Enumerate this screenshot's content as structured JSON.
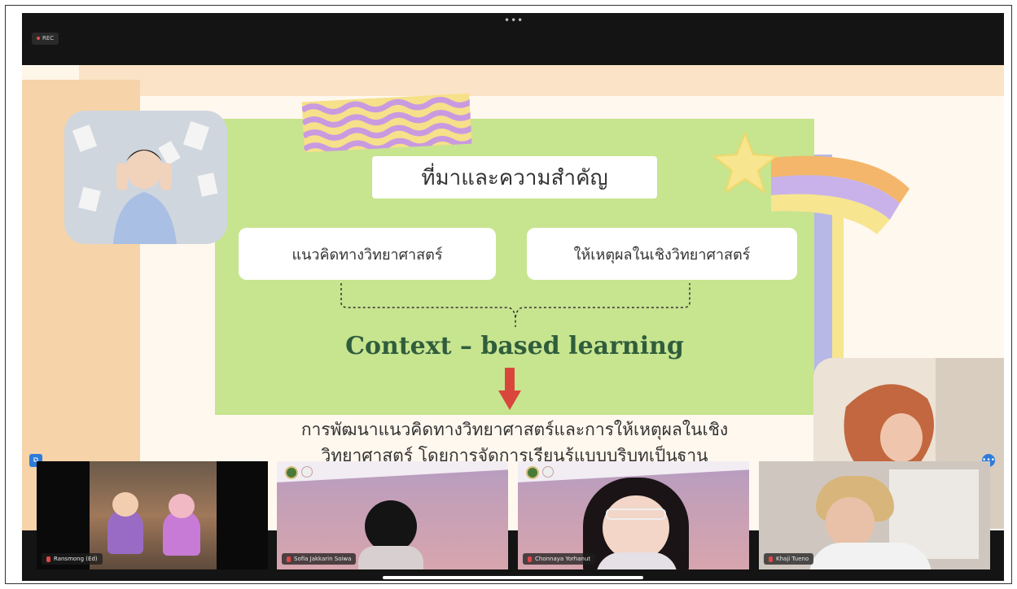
{
  "meeting": {
    "rec_label": "REC"
  },
  "slide": {
    "title": "ที่มาและความสำคัญ",
    "pill_left": "แนวคิดทางวิทยาศาสตร์",
    "pill_right": "ให้เหตุผลในเชิงวิทยาศาสตร์",
    "approach": "Context – based learning",
    "result_line1": "การพัฒนาแนวคิดทางวิทยาศาสตร์และการให้เหตุผลในเชิง",
    "result_line2": "วิทยาศาสตร์ โดยการจัดการเรียนรู้แบบบริบทเป็นฐาน"
  },
  "participants": [
    {
      "name": "Ransmong (Ed)"
    },
    {
      "name": "Sofia Jakkarin Soiwa"
    },
    {
      "name": "Chonnaya Yorhanut"
    },
    {
      "name": "Khaji Tueno"
    }
  ],
  "icons": {
    "more": "more-dots-icon",
    "star": "star-icon",
    "arrow": "down-arrow-icon",
    "mic": "mic-muted-icon"
  },
  "colors": {
    "slide_green": "#c7e48f",
    "heading_green": "#2f5d3c",
    "arrow_red": "#d9473c",
    "toolbar": "#141414"
  }
}
